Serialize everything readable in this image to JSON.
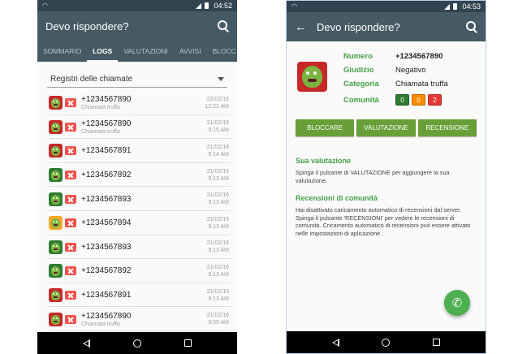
{
  "left_screen": {
    "status": {
      "time": "04:52"
    },
    "appbar": {
      "title": "Devo rispondere?"
    },
    "tabs": [
      {
        "label": "SOMMARIO",
        "active": false
      },
      {
        "label": "LOGS",
        "active": true
      },
      {
        "label": "VALUTAZIONI",
        "active": false
      },
      {
        "label": "AVVISI",
        "active": false
      },
      {
        "label": "BLOCC",
        "active": false
      }
    ],
    "dropdown": {
      "selected": "Registri delle chiamate"
    },
    "calls": [
      {
        "number": "+1234567890",
        "subtitle": "Chiamata truffa",
        "date": "22/02/16",
        "time": "12:22 AM",
        "rating": "red"
      },
      {
        "number": "+1234567890",
        "subtitle": "Chiamata truffa",
        "date": "21/02/16",
        "time": "9:15 AM",
        "rating": "red"
      },
      {
        "number": "+1234567891",
        "subtitle": "",
        "date": "21/02/16",
        "time": "9:14 AM",
        "rating": "red"
      },
      {
        "number": "+1234567892",
        "subtitle": "",
        "date": "21/02/16",
        "time": "9:13 AM",
        "rating": "green"
      },
      {
        "number": "+1234567893",
        "subtitle": "",
        "date": "21/02/16",
        "time": "9:13 AM",
        "rating": "green"
      },
      {
        "number": "+1234567894",
        "subtitle": "",
        "date": "21/02/16",
        "time": "9:13 AM",
        "rating": "yellow"
      },
      {
        "number": "+1234567893",
        "subtitle": "",
        "date": "21/02/16",
        "time": "9:13 AM",
        "rating": "green"
      },
      {
        "number": "+1234567892",
        "subtitle": "",
        "date": "21/02/16",
        "time": "9:13 AM",
        "rating": "green"
      },
      {
        "number": "+1234567891",
        "subtitle": "",
        "date": "21/02/16",
        "time": "9:13 AM",
        "rating": "red"
      },
      {
        "number": "+1234567890",
        "subtitle": "Chiamata truffa",
        "date": "21/02/16",
        "time": "9:09 AM",
        "rating": "red"
      }
    ]
  },
  "right_screen": {
    "status": {
      "time": "04:53"
    },
    "appbar": {
      "title": "Devo rispondere?"
    },
    "details": {
      "number_label": "Numero",
      "number_value": "+1234567890",
      "judgement_label": "Giudizio",
      "judgement_value": "Negativo",
      "category_label": "Categoria",
      "category_value": "Chiamata truffa",
      "community_label": "Comunità",
      "community_counts": [
        {
          "value": "0",
          "color": "#2e7d32"
        },
        {
          "value": "0",
          "color": "#fb8c00"
        },
        {
          "value": "2",
          "color": "#e53935"
        }
      ]
    },
    "buttons": {
      "block": "BLOCCARE",
      "rate": "VALUTAZIONE",
      "review": "RECENSIONE"
    },
    "own_rating": {
      "title": "Sua valutazione",
      "text": "Spinga il pulsante di VALUTAZIONE per aggiungere la sua valutazione."
    },
    "community_reviews": {
      "title": "Recensioni di comunità",
      "text": "Hai disattivato caricamento automatico di recensioni dal server. Spinga il pulsante 'RECENSIONI' per vedere le recensioni di comunità. Cricamento automatico di recensioni può essere attivato nelle impostazioni di aplicazione."
    }
  },
  "colors": {
    "appbar": "#455a64",
    "statusbar": "#32444f",
    "accent_green": "#43a047",
    "button_green": "#689f38",
    "fab_green": "#4caf50"
  },
  "icons": {
    "search": "search-icon",
    "back": "arrow-back-icon",
    "call": "phone-icon",
    "blocked": "blocked-call-icon"
  }
}
